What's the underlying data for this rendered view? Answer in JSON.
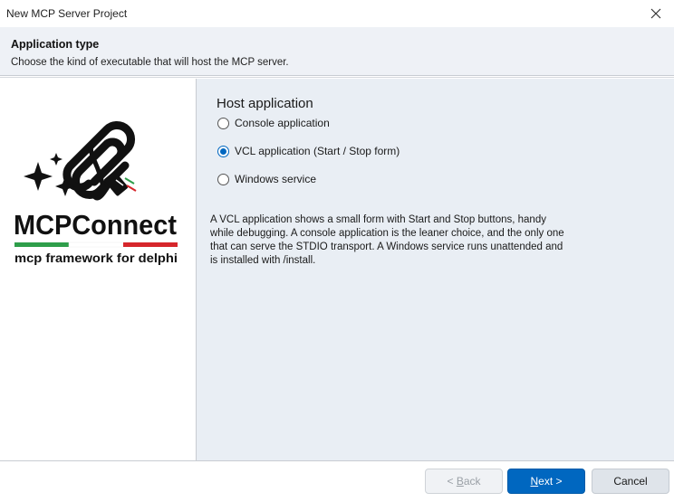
{
  "window": {
    "title": "New MCP Server Project"
  },
  "header": {
    "title": "Application type",
    "subtitle": "Choose the kind of executable that will host the MCP server."
  },
  "logo": {
    "brand": "MCPConnect",
    "tagline": "mcp framework for delphi",
    "flag_colors": [
      "#2e9e4a",
      "#ffffff",
      "#d6262b"
    ]
  },
  "host_group": {
    "title": "Host application",
    "options": [
      {
        "label": "Console application",
        "checked": false
      },
      {
        "label": "VCL application (Start / Stop form)",
        "checked": true
      },
      {
        "label": "Windows service",
        "checked": false
      }
    ]
  },
  "description": "A VCL application shows a small form with Start and Stop buttons, handy while debugging. A console application is the leaner choice, and the only one that can serve the STDIO transport. A Windows service runs unattended and is installed with /install.",
  "buttons": {
    "back": {
      "prefix": "< ",
      "mnemonic": "B",
      "rest": "ack",
      "enabled": false
    },
    "next": {
      "mnemonic": "N",
      "rest": "ext >",
      "enabled": true
    },
    "cancel": "Cancel"
  },
  "colors": {
    "accent": "#0067c0",
    "header_bg": "#eef1f6",
    "panel_bg": "#e9eef4"
  }
}
